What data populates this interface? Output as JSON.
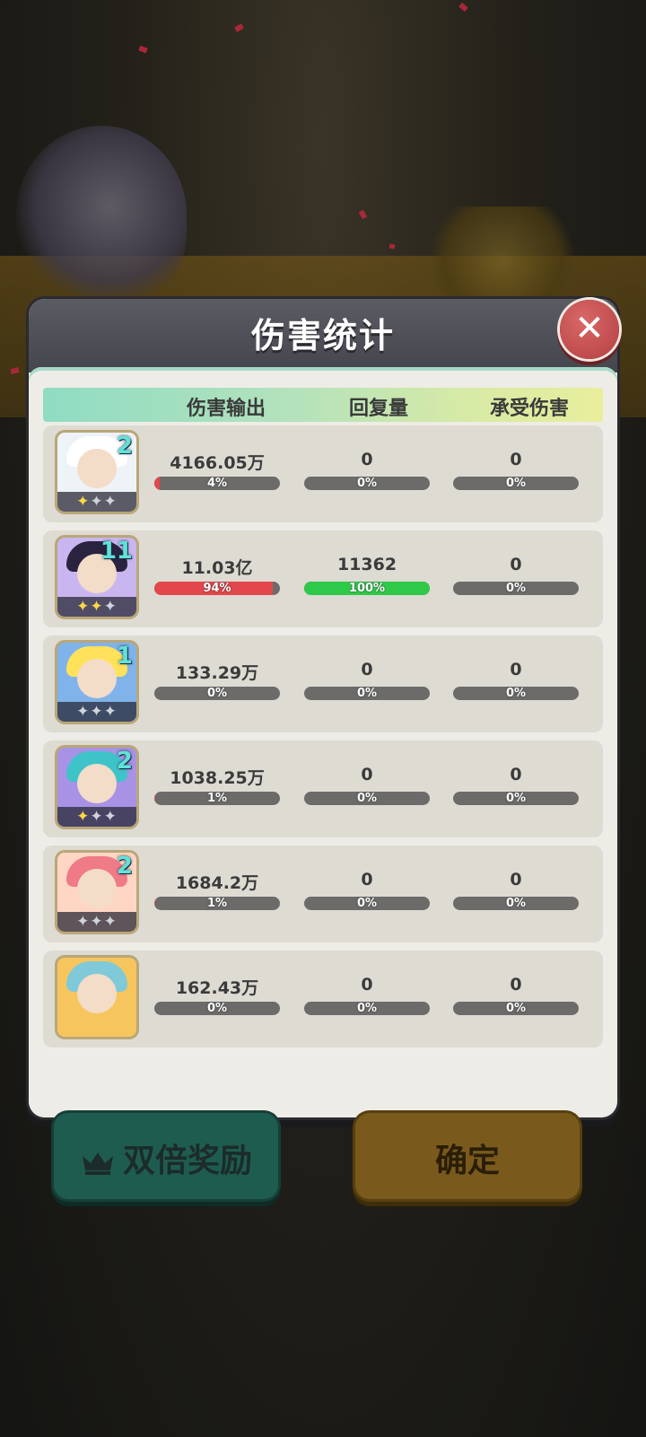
{
  "dialog": {
    "title": "伤害统计",
    "close_icon": "close-icon"
  },
  "columns": {
    "damage": "伤害输出",
    "heal": "回复量",
    "taken": "承受伤害"
  },
  "rows": [
    {
      "level": "2",
      "stars": 1,
      "damage": "4166.05万",
      "damage_pct": "4%",
      "damage_fill": 0.04,
      "heal": "0",
      "heal_pct": "0%",
      "heal_fill": 0,
      "taken": "0",
      "taken_pct": "0%",
      "taken_fill": 0,
      "bg": "#eef3f7",
      "hair": "#ffffff"
    },
    {
      "level": "11",
      "stars": 2,
      "damage": "11.03亿",
      "damage_pct": "94%",
      "damage_fill": 0.94,
      "heal": "11362",
      "heal_pct": "100%",
      "heal_fill": 1.0,
      "taken": "0",
      "taken_pct": "0%",
      "taken_fill": 0,
      "bg": "#c9b6f0",
      "hair": "#2a2340"
    },
    {
      "level": "1",
      "stars": 0,
      "damage": "133.29万",
      "damage_pct": "0%",
      "damage_fill": 0,
      "heal": "0",
      "heal_pct": "0%",
      "heal_fill": 0,
      "taken": "0",
      "taken_pct": "0%",
      "taken_fill": 0,
      "bg": "#7fb3ea",
      "hair": "#ffe25a"
    },
    {
      "level": "2",
      "stars": 1,
      "damage": "1038.25万",
      "damage_pct": "1%",
      "damage_fill": 0.01,
      "heal": "0",
      "heal_pct": "0%",
      "heal_fill": 0,
      "taken": "0",
      "taken_pct": "0%",
      "taken_fill": 0,
      "bg": "#a892e6",
      "hair": "#3ec3c9"
    },
    {
      "level": "2",
      "stars": 0,
      "damage": "1684.2万",
      "damage_pct": "1%",
      "damage_fill": 0.01,
      "heal": "0",
      "heal_pct": "0%",
      "heal_fill": 0,
      "taken": "0",
      "taken_pct": "0%",
      "taken_fill": 0,
      "bg": "#ffd6c4",
      "hair": "#ef7a88"
    },
    {
      "level": "",
      "stars": 0,
      "damage": "162.43万",
      "damage_pct": "0%",
      "damage_fill": 0,
      "heal": "0",
      "heal_pct": "0%",
      "heal_fill": 0,
      "taken": "0",
      "taken_pct": "0%",
      "taken_fill": 0,
      "bg": "#f7c55e",
      "hair": "#7fc9d9"
    }
  ],
  "colors": {
    "damage_fill": "#e2474c",
    "heal_fill": "#2fc94a",
    "track": "#6c6b6a"
  },
  "buttons": {
    "double_reward": "双倍奖励",
    "confirm": "确定",
    "crown_icon": "crown-icon"
  }
}
